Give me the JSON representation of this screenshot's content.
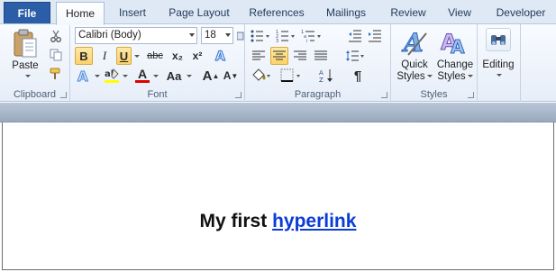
{
  "tabs": [
    {
      "id": "file",
      "label": "File"
    },
    {
      "id": "home",
      "label": "Home"
    },
    {
      "id": "insert",
      "label": "Insert"
    },
    {
      "id": "page-layout",
      "label": "Page Layout"
    },
    {
      "id": "references",
      "label": "References"
    },
    {
      "id": "mailings",
      "label": "Mailings"
    },
    {
      "id": "review",
      "label": "Review"
    },
    {
      "id": "view",
      "label": "View"
    },
    {
      "id": "developer",
      "label": "Developer"
    }
  ],
  "active_tab": "Home",
  "clipboard": {
    "group_label": "Clipboard",
    "paste_label": "Paste"
  },
  "font": {
    "group_label": "Font",
    "font_name": "Calibri (Body)",
    "font_size": "18",
    "bold": "B",
    "italic": "I",
    "underline": "U",
    "strike": "abc",
    "subscript": "x₂",
    "superscript": "x²",
    "font_color_glyph": "A",
    "change_case": "Aa",
    "grow": "A",
    "shrink": "A"
  },
  "paragraph": {
    "group_label": "Paragraph",
    "pilcrow": "¶"
  },
  "styles": {
    "group_label": "Styles",
    "quick_styles_line1": "Quick",
    "quick_styles_line2": "Styles",
    "change_styles_line1": "Change",
    "change_styles_line2": "Styles"
  },
  "editing": {
    "label": "Editing"
  },
  "document": {
    "text_plain": "My first ",
    "text_link": "hyperlink"
  },
  "colors": {
    "accent": "#2b5ea7",
    "link": "#0b3cd8",
    "highlight": "#fbd26a",
    "font_color_bar": "#e00000"
  }
}
